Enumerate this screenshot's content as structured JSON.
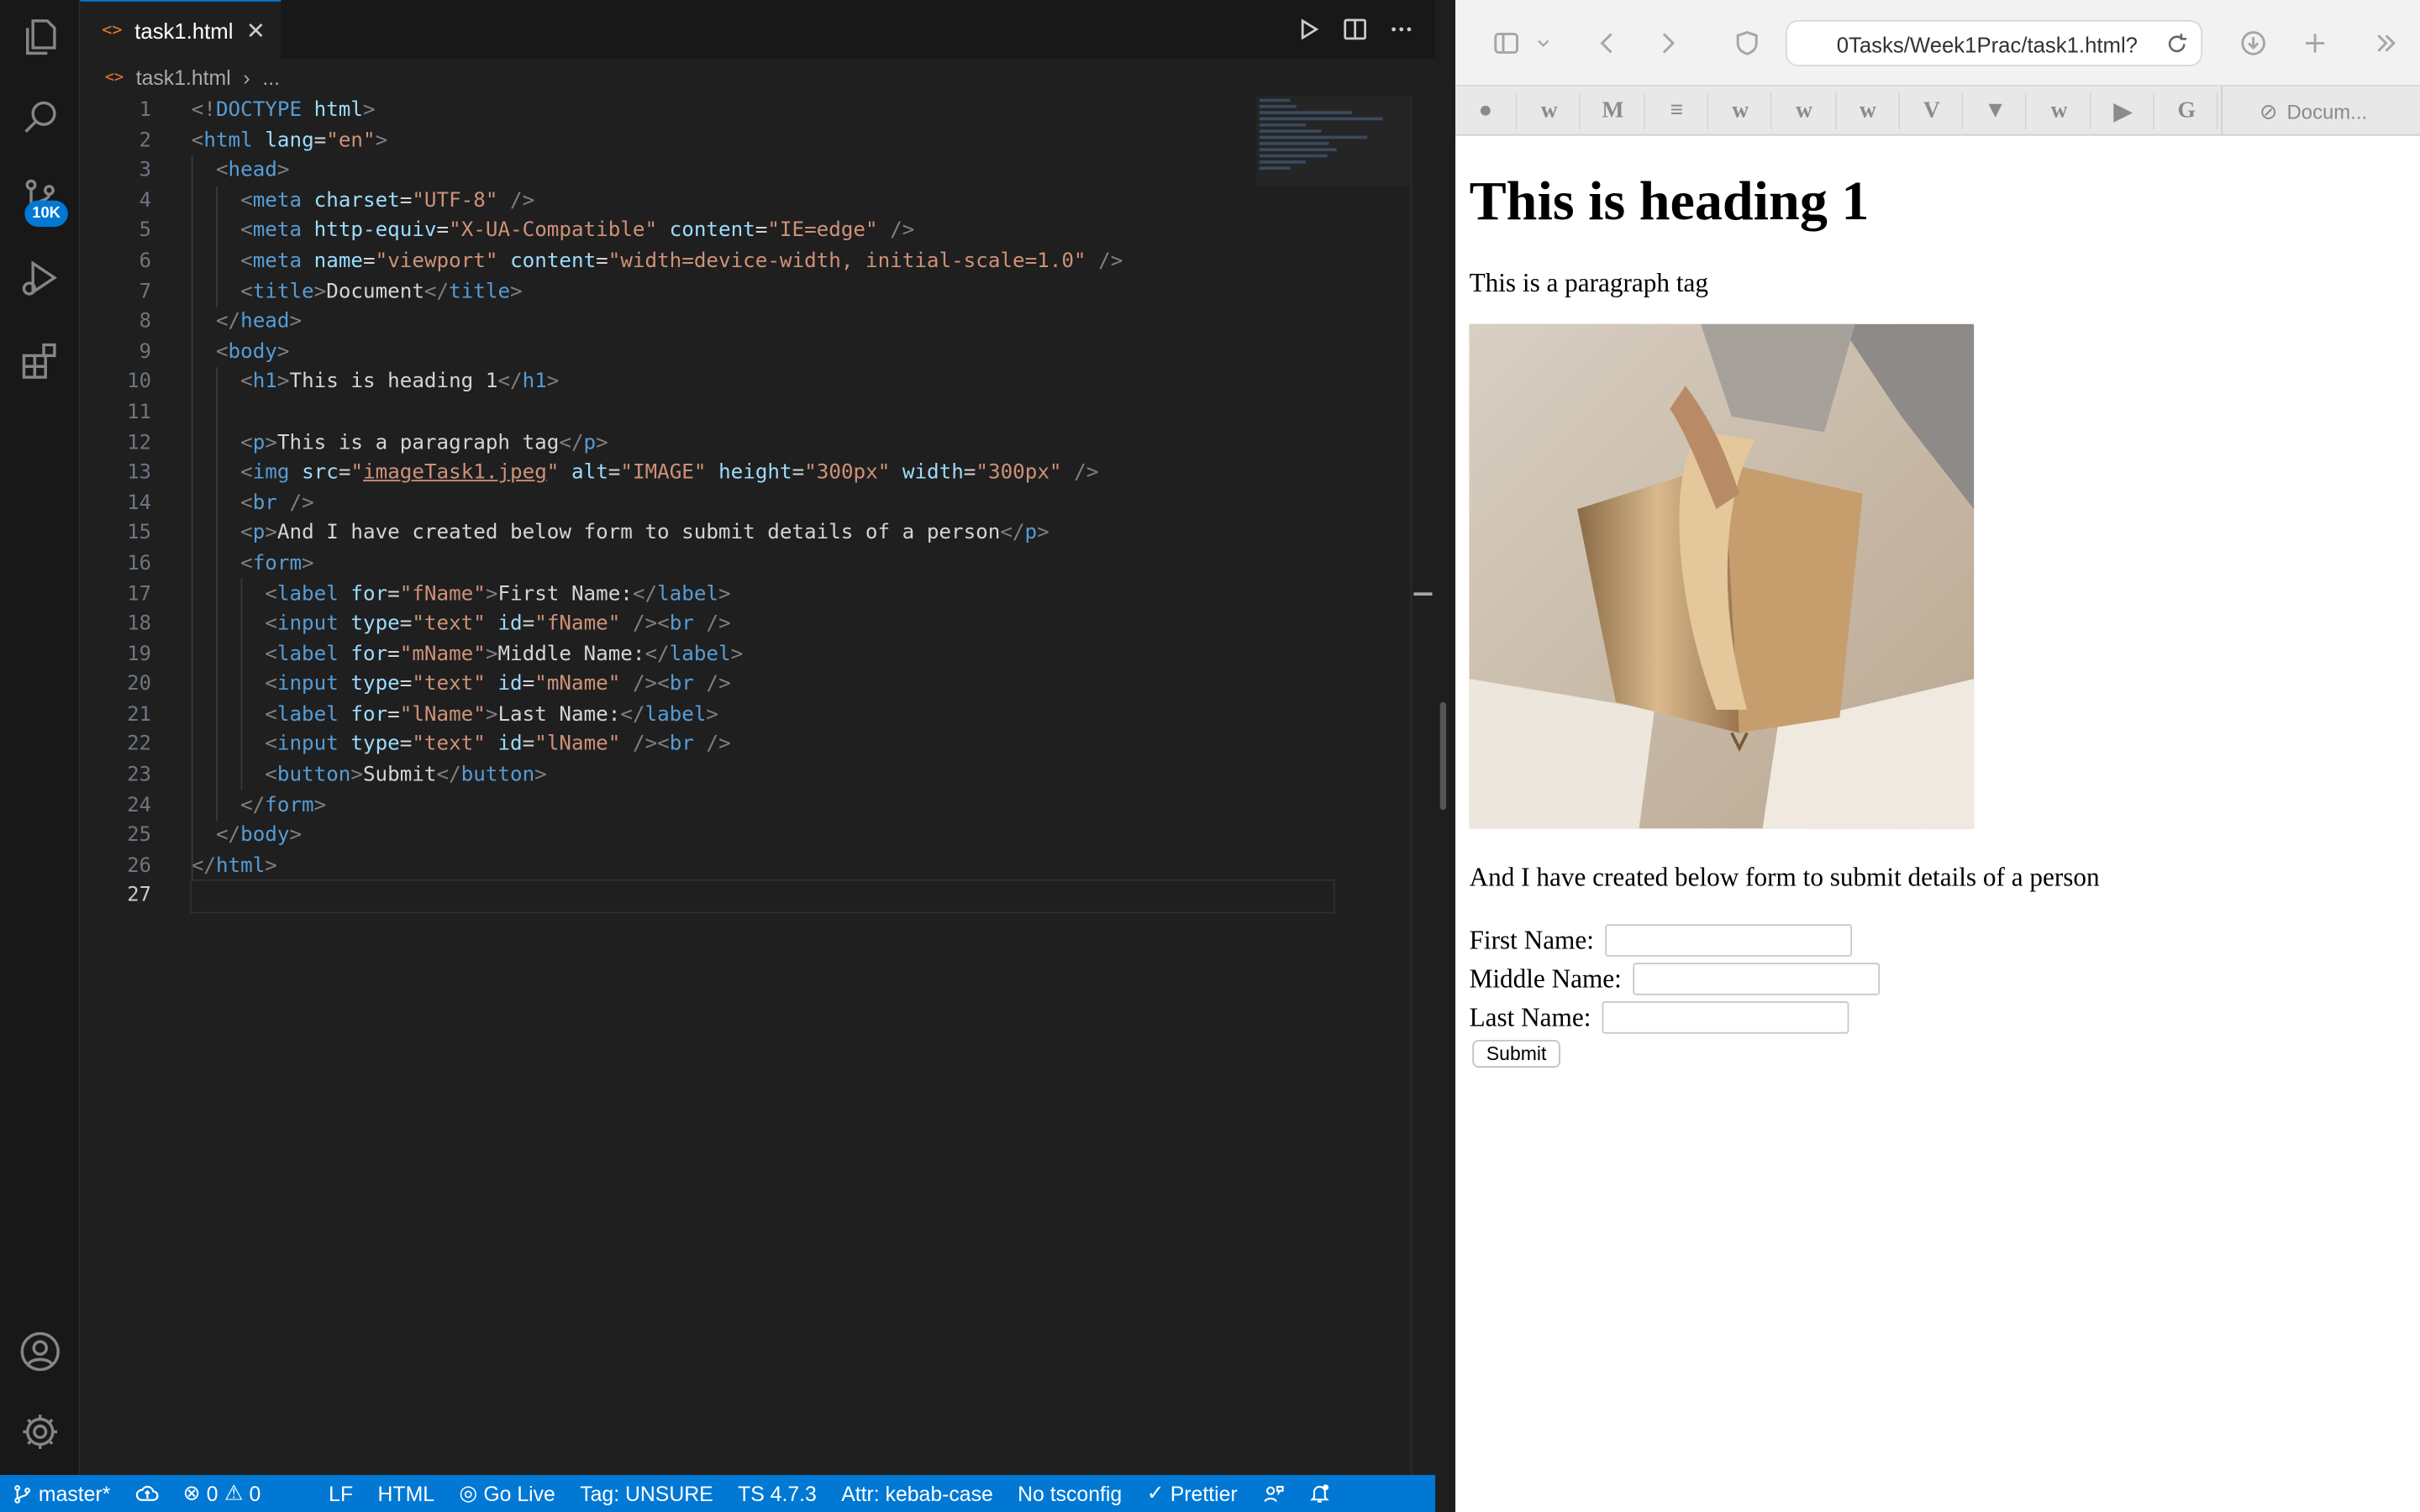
{
  "editor": {
    "tab_filename": "task1.html",
    "tab_file_icon": "<>",
    "tab_close": "✕",
    "breadcrumb": {
      "file": "task1.html",
      "sep": "›",
      "rest": "..."
    },
    "source_control_badge": "10K",
    "line_numbers": [
      "1",
      "2",
      "3",
      "4",
      "5",
      "6",
      "7",
      "8",
      "9",
      "10",
      "11",
      "12",
      "13",
      "14",
      "15",
      "16",
      "17",
      "18",
      "19",
      "20",
      "21",
      "22",
      "23",
      "24",
      "25",
      "26",
      "27"
    ],
    "current_line": "27",
    "lines": [
      [
        [
          "b",
          "<!"
        ],
        [
          "tag",
          "DOCTYPE"
        ],
        [
          "txt",
          " "
        ],
        [
          "attr",
          "html"
        ],
        [
          "b",
          ">"
        ]
      ],
      [
        [
          "b",
          "<"
        ],
        [
          "tag",
          "html"
        ],
        [
          "txt",
          " "
        ],
        [
          "attr",
          "lang"
        ],
        [
          "txt",
          "="
        ],
        [
          "str",
          "\"en\""
        ],
        [
          "b",
          ">"
        ]
      ],
      [
        [
          "txt",
          "  "
        ],
        [
          "b",
          "<"
        ],
        [
          "tag",
          "head"
        ],
        [
          "b",
          ">"
        ]
      ],
      [
        [
          "txt",
          "    "
        ],
        [
          "b",
          "<"
        ],
        [
          "tag",
          "meta"
        ],
        [
          "txt",
          " "
        ],
        [
          "attr",
          "charset"
        ],
        [
          "txt",
          "="
        ],
        [
          "str",
          "\"UTF-8\""
        ],
        [
          "txt",
          " "
        ],
        [
          "b",
          "/>"
        ]
      ],
      [
        [
          "txt",
          "    "
        ],
        [
          "b",
          "<"
        ],
        [
          "tag",
          "meta"
        ],
        [
          "txt",
          " "
        ],
        [
          "attr",
          "http-equiv"
        ],
        [
          "txt",
          "="
        ],
        [
          "str",
          "\"X-UA-Compatible\""
        ],
        [
          "txt",
          " "
        ],
        [
          "attr",
          "content"
        ],
        [
          "txt",
          "="
        ],
        [
          "str",
          "\"IE=edge\""
        ],
        [
          "txt",
          " "
        ],
        [
          "b",
          "/>"
        ]
      ],
      [
        [
          "txt",
          "    "
        ],
        [
          "b",
          "<"
        ],
        [
          "tag",
          "meta"
        ],
        [
          "txt",
          " "
        ],
        [
          "attr",
          "name"
        ],
        [
          "txt",
          "="
        ],
        [
          "str",
          "\"viewport\""
        ],
        [
          "txt",
          " "
        ],
        [
          "attr",
          "content"
        ],
        [
          "txt",
          "="
        ],
        [
          "str",
          "\"width=device-width, initial-scale=1.0\""
        ],
        [
          "txt",
          " "
        ],
        [
          "b",
          "/>"
        ]
      ],
      [
        [
          "txt",
          "    "
        ],
        [
          "b",
          "<"
        ],
        [
          "tag",
          "title"
        ],
        [
          "b",
          ">"
        ],
        [
          "txt",
          "Document"
        ],
        [
          "b",
          "</"
        ],
        [
          "tag",
          "title"
        ],
        [
          "b",
          ">"
        ]
      ],
      [
        [
          "txt",
          "  "
        ],
        [
          "b",
          "</"
        ],
        [
          "tag",
          "head"
        ],
        [
          "b",
          ">"
        ]
      ],
      [
        [
          "txt",
          "  "
        ],
        [
          "b",
          "<"
        ],
        [
          "tag",
          "body"
        ],
        [
          "b",
          ">"
        ]
      ],
      [
        [
          "txt",
          "    "
        ],
        [
          "b",
          "<"
        ],
        [
          "tag",
          "h1"
        ],
        [
          "b",
          ">"
        ],
        [
          "txt",
          "This is heading 1"
        ],
        [
          "b",
          "</"
        ],
        [
          "tag",
          "h1"
        ],
        [
          "b",
          ">"
        ]
      ],
      [
        [
          "txt",
          ""
        ]
      ],
      [
        [
          "txt",
          "    "
        ],
        [
          "b",
          "<"
        ],
        [
          "tag",
          "p"
        ],
        [
          "b",
          ">"
        ],
        [
          "txt",
          "This is a paragraph tag"
        ],
        [
          "b",
          "</"
        ],
        [
          "tag",
          "p"
        ],
        [
          "b",
          ">"
        ]
      ],
      [
        [
          "txt",
          "    "
        ],
        [
          "b",
          "<"
        ],
        [
          "tag",
          "img"
        ],
        [
          "txt",
          " "
        ],
        [
          "attr",
          "src"
        ],
        [
          "txt",
          "="
        ],
        [
          "str",
          "\""
        ],
        [
          "link",
          "imageTask1.jpeg"
        ],
        [
          "str",
          "\""
        ],
        [
          "txt",
          " "
        ],
        [
          "attr",
          "alt"
        ],
        [
          "txt",
          "="
        ],
        [
          "str",
          "\"IMAGE\""
        ],
        [
          "txt",
          " "
        ],
        [
          "attr",
          "height"
        ],
        [
          "txt",
          "="
        ],
        [
          "str",
          "\"300px\""
        ],
        [
          "txt",
          " "
        ],
        [
          "attr",
          "width"
        ],
        [
          "txt",
          "="
        ],
        [
          "str",
          "\"300px\""
        ],
        [
          "txt",
          " "
        ],
        [
          "b",
          "/>"
        ]
      ],
      [
        [
          "txt",
          "    "
        ],
        [
          "b",
          "<"
        ],
        [
          "tag",
          "br"
        ],
        [
          "txt",
          " "
        ],
        [
          "b",
          "/>"
        ]
      ],
      [
        [
          "txt",
          "    "
        ],
        [
          "b",
          "<"
        ],
        [
          "tag",
          "p"
        ],
        [
          "b",
          ">"
        ],
        [
          "txt",
          "And I have created below form to submit details of a person"
        ],
        [
          "b",
          "</"
        ],
        [
          "tag",
          "p"
        ],
        [
          "b",
          ">"
        ]
      ],
      [
        [
          "txt",
          "    "
        ],
        [
          "b",
          "<"
        ],
        [
          "tag",
          "form"
        ],
        [
          "b",
          ">"
        ]
      ],
      [
        [
          "txt",
          "      "
        ],
        [
          "b",
          "<"
        ],
        [
          "tag",
          "label"
        ],
        [
          "txt",
          " "
        ],
        [
          "attr",
          "for"
        ],
        [
          "txt",
          "="
        ],
        [
          "str",
          "\"fName\""
        ],
        [
          "b",
          ">"
        ],
        [
          "txt",
          "First Name:"
        ],
        [
          "b",
          "</"
        ],
        [
          "tag",
          "label"
        ],
        [
          "b",
          ">"
        ]
      ],
      [
        [
          "txt",
          "      "
        ],
        [
          "b",
          "<"
        ],
        [
          "tag",
          "input"
        ],
        [
          "txt",
          " "
        ],
        [
          "attr",
          "type"
        ],
        [
          "txt",
          "="
        ],
        [
          "str",
          "\"text\""
        ],
        [
          "txt",
          " "
        ],
        [
          "attr",
          "id"
        ],
        [
          "txt",
          "="
        ],
        [
          "str",
          "\"fName\""
        ],
        [
          "txt",
          " "
        ],
        [
          "b",
          "/><"
        ],
        [
          "tag",
          "br"
        ],
        [
          "txt",
          " "
        ],
        [
          "b",
          "/>"
        ]
      ],
      [
        [
          "txt",
          "      "
        ],
        [
          "b",
          "<"
        ],
        [
          "tag",
          "label"
        ],
        [
          "txt",
          " "
        ],
        [
          "attr",
          "for"
        ],
        [
          "txt",
          "="
        ],
        [
          "str",
          "\"mName\""
        ],
        [
          "b",
          ">"
        ],
        [
          "txt",
          "Middle Name:"
        ],
        [
          "b",
          "</"
        ],
        [
          "tag",
          "label"
        ],
        [
          "b",
          ">"
        ]
      ],
      [
        [
          "txt",
          "      "
        ],
        [
          "b",
          "<"
        ],
        [
          "tag",
          "input"
        ],
        [
          "txt",
          " "
        ],
        [
          "attr",
          "type"
        ],
        [
          "txt",
          "="
        ],
        [
          "str",
          "\"text\""
        ],
        [
          "txt",
          " "
        ],
        [
          "attr",
          "id"
        ],
        [
          "txt",
          "="
        ],
        [
          "str",
          "\"mName\""
        ],
        [
          "txt",
          " "
        ],
        [
          "b",
          "/><"
        ],
        [
          "tag",
          "br"
        ],
        [
          "txt",
          " "
        ],
        [
          "b",
          "/>"
        ]
      ],
      [
        [
          "txt",
          "      "
        ],
        [
          "b",
          "<"
        ],
        [
          "tag",
          "label"
        ],
        [
          "txt",
          " "
        ],
        [
          "attr",
          "for"
        ],
        [
          "txt",
          "="
        ],
        [
          "str",
          "\"lName\""
        ],
        [
          "b",
          ">"
        ],
        [
          "txt",
          "Last Name:"
        ],
        [
          "b",
          "</"
        ],
        [
          "tag",
          "label"
        ],
        [
          "b",
          ">"
        ]
      ],
      [
        [
          "txt",
          "      "
        ],
        [
          "b",
          "<"
        ],
        [
          "tag",
          "input"
        ],
        [
          "txt",
          " "
        ],
        [
          "attr",
          "type"
        ],
        [
          "txt",
          "="
        ],
        [
          "str",
          "\"text\""
        ],
        [
          "txt",
          " "
        ],
        [
          "attr",
          "id"
        ],
        [
          "txt",
          "="
        ],
        [
          "str",
          "\"lName\""
        ],
        [
          "txt",
          " "
        ],
        [
          "b",
          "/><"
        ],
        [
          "tag",
          "br"
        ],
        [
          "txt",
          " "
        ],
        [
          "b",
          "/>"
        ]
      ],
      [
        [
          "txt",
          "      "
        ],
        [
          "b",
          "<"
        ],
        [
          "tag",
          "button"
        ],
        [
          "b",
          ">"
        ],
        [
          "txt",
          "Submit"
        ],
        [
          "b",
          "</"
        ],
        [
          "tag",
          "button"
        ],
        [
          "b",
          ">"
        ]
      ],
      [
        [
          "txt",
          "    "
        ],
        [
          "b",
          "</"
        ],
        [
          "tag",
          "form"
        ],
        [
          "b",
          ">"
        ]
      ],
      [
        [
          "txt",
          "  "
        ],
        [
          "b",
          "</"
        ],
        [
          "tag",
          "body"
        ],
        [
          "b",
          ">"
        ]
      ],
      [
        [
          "b",
          "</"
        ],
        [
          "tag",
          "html"
        ],
        [
          "b",
          ">"
        ]
      ],
      [
        [
          "txt",
          ""
        ]
      ]
    ]
  },
  "statusbar": {
    "branch": "master*",
    "errors": "0",
    "warnings": "0",
    "eol": "LF",
    "language": "HTML",
    "go_live": "Go Live",
    "tag": "Tag: UNSURE",
    "ts": "TS 4.7.3",
    "attr": "Attr: kebab-case",
    "tsconfig": "No tsconfig",
    "prettier": "Prettier",
    "color": "#0078d4"
  },
  "browser": {
    "url": "0Tasks/Week1Prac/task1.html?",
    "bookmarks": [
      "github-icon",
      "w3-icon",
      "gmail-icon",
      "stackoverflow-icon",
      "w3-icon",
      "w3-icon",
      "w3-icon",
      "v-icon",
      "vuetify-icon",
      "w3-icon",
      "youtube-icon",
      "google-icon"
    ],
    "bookmark_tab": "Docum...",
    "page": {
      "h1": "This is heading 1",
      "p1": "This is a paragraph tag",
      "p2": "And I have created below form to submit details of a person",
      "first_label": "First Name:",
      "middle_label": "Middle Name:",
      "last_label": "Last Name:",
      "submit": "Submit"
    }
  }
}
